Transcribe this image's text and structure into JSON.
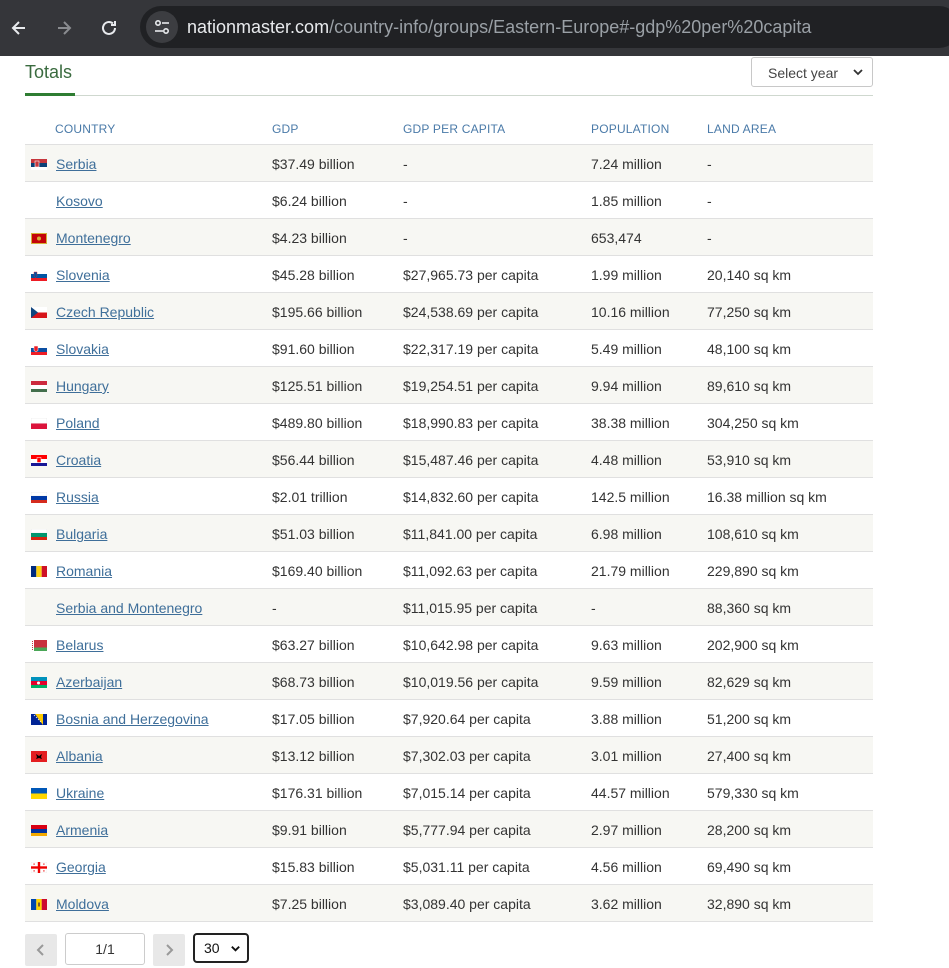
{
  "browser": {
    "url_host": "nationmaster.com",
    "url_path": "/country-info/groups/Eastern-Europe#-gdp%20per%20capita"
  },
  "section": {
    "title": "Totals",
    "year_select_label": "Select year"
  },
  "table": {
    "headers": {
      "country": "COUNTRY",
      "gdp": "GDP",
      "gdp_per_capita": "GDP PER CAPITA",
      "population": "POPULATION",
      "land_area": "LAND AREA"
    },
    "rows": [
      {
        "country": "Serbia",
        "gdp": "$37.49 billion",
        "per_capita": "-",
        "population": "7.24 million",
        "land": "-",
        "flag": "serbia"
      },
      {
        "country": "Kosovo",
        "gdp": "$6.24 billion",
        "per_capita": "-",
        "population": "1.85 million",
        "land": "-",
        "flag": "none"
      },
      {
        "country": "Montenegro",
        "gdp": "$4.23 billion",
        "per_capita": "-",
        "population": "653,474",
        "land": "-",
        "flag": "montenegro"
      },
      {
        "country": "Slovenia",
        "gdp": "$45.28 billion",
        "per_capita": "$27,965.73 per capita",
        "population": "1.99 million",
        "land": "20,140 sq km",
        "flag": "slovenia"
      },
      {
        "country": "Czech Republic",
        "gdp": "$195.66 billion",
        "per_capita": "$24,538.69 per capita",
        "population": "10.16 million",
        "land": "77,250 sq km",
        "flag": "czech"
      },
      {
        "country": "Slovakia",
        "gdp": "$91.60 billion",
        "per_capita": "$22,317.19 per capita",
        "population": "5.49 million",
        "land": "48,100 sq km",
        "flag": "slovakia"
      },
      {
        "country": "Hungary",
        "gdp": "$125.51 billion",
        "per_capita": "$19,254.51 per capita",
        "population": "9.94 million",
        "land": "89,610 sq km",
        "flag": "hungary"
      },
      {
        "country": "Poland",
        "gdp": "$489.80 billion",
        "per_capita": "$18,990.83 per capita",
        "population": "38.38 million",
        "land": "304,250 sq km",
        "flag": "poland"
      },
      {
        "country": "Croatia",
        "gdp": "$56.44 billion",
        "per_capita": "$15,487.46 per capita",
        "population": "4.48 million",
        "land": "53,910 sq km",
        "flag": "croatia"
      },
      {
        "country": "Russia",
        "gdp": "$2.01 trillion",
        "per_capita": "$14,832.60 per capita",
        "population": "142.5 million",
        "land": "16.38 million sq km",
        "flag": "russia"
      },
      {
        "country": "Bulgaria",
        "gdp": "$51.03 billion",
        "per_capita": "$11,841.00 per capita",
        "population": "6.98 million",
        "land": "108,610 sq km",
        "flag": "bulgaria"
      },
      {
        "country": "Romania",
        "gdp": "$169.40 billion",
        "per_capita": "$11,092.63 per capita",
        "population": "21.79 million",
        "land": "229,890 sq km",
        "flag": "romania"
      },
      {
        "country": "Serbia and Montenegro",
        "gdp": "-",
        "per_capita": "$11,015.95 per capita",
        "population": "-",
        "land": "88,360 sq km",
        "flag": "none"
      },
      {
        "country": "Belarus",
        "gdp": "$63.27 billion",
        "per_capita": "$10,642.98 per capita",
        "population": "9.63 million",
        "land": "202,900 sq km",
        "flag": "belarus"
      },
      {
        "country": "Azerbaijan",
        "gdp": "$68.73 billion",
        "per_capita": "$10,019.56 per capita",
        "population": "9.59 million",
        "land": "82,629 sq km",
        "flag": "azerbaijan"
      },
      {
        "country": "Bosnia and Herzegovina",
        "gdp": "$17.05 billion",
        "per_capita": "$7,920.64 per capita",
        "population": "3.88 million",
        "land": "51,200 sq km",
        "flag": "bosnia"
      },
      {
        "country": "Albania",
        "gdp": "$13.12 billion",
        "per_capita": "$7,302.03 per capita",
        "population": "3.01 million",
        "land": "27,400 sq km",
        "flag": "albania"
      },
      {
        "country": "Ukraine",
        "gdp": "$176.31 billion",
        "per_capita": "$7,015.14 per capita",
        "population": "44.57 million",
        "land": "579,330 sq km",
        "flag": "ukraine"
      },
      {
        "country": "Armenia",
        "gdp": "$9.91 billion",
        "per_capita": "$5,777.94 per capita",
        "population": "2.97 million",
        "land": "28,200 sq km",
        "flag": "armenia"
      },
      {
        "country": "Georgia",
        "gdp": "$15.83 billion",
        "per_capita": "$5,031.11 per capita",
        "population": "4.56 million",
        "land": "69,490 sq km",
        "flag": "georgia"
      },
      {
        "country": "Moldova",
        "gdp": "$7.25 billion",
        "per_capita": "$3,089.40 per capita",
        "population": "3.62 million",
        "land": "32,890 sq km",
        "flag": "moldova"
      }
    ]
  },
  "pagination": {
    "page_value": "1/1",
    "page_size": "30"
  },
  "colors": {
    "accent_green": "#2e7d32",
    "link_blue": "#3f6f9a",
    "header_blue": "#4a7aa8",
    "row_alt": "#f7f7f3"
  }
}
